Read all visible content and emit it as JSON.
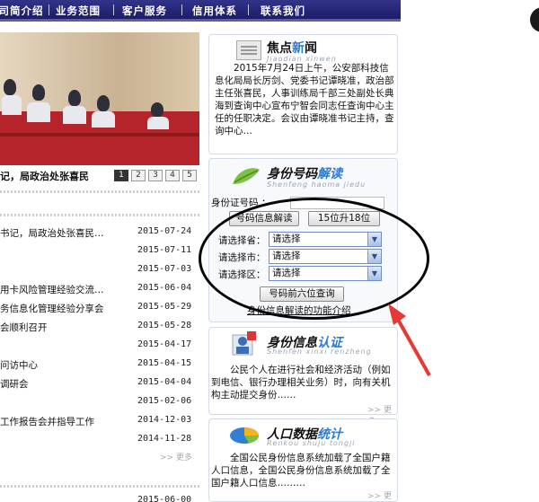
{
  "nav": {
    "items": [
      "公司简介绍",
      "业务范围",
      "客户服务",
      "信用体系",
      "联系我们"
    ]
  },
  "slideshow": {
    "caption": "记，局政治处张喜民",
    "pages": [
      "1",
      "2",
      "3",
      "4",
      "5"
    ],
    "active_page": "1"
  },
  "news": [
    {
      "title": "书记，局政治处张喜民…",
      "date": "2015-07-24"
    },
    {
      "title": "",
      "date": "2015-07-11"
    },
    {
      "title": "",
      "date": "2015-07-03"
    },
    {
      "title": "用卡风险管理经验交流…",
      "date": "2015-06-04"
    },
    {
      "title": "务信息化管理经验分享会",
      "date": "2015-05-29"
    },
    {
      "title": "会顺利召开",
      "date": "2015-05-28"
    },
    {
      "title": "",
      "date": "2015-04-17"
    },
    {
      "title": "问访中心",
      "date": "2015-04-15"
    },
    {
      "title": "调研会",
      "date": "2015-04-04"
    },
    {
      "title": "",
      "date": "2015-02-06"
    },
    {
      "title": "工作报告会并指导工作",
      "date": "2014-12-03"
    },
    {
      "title": "",
      "date": "2014-11-28"
    }
  ],
  "news_partial_date": "2015-06-00",
  "focus": {
    "title_a": "焦点",
    "title_b": "新",
    "title_c": "闻",
    "sub": "Jiaodian  xinwen",
    "body": "2015年7月24日上午，公安部科技信息化局局长厉剑、党委书记谭晓准，政治部主任张喜民，人事训练局千部三处副处长典海到查询中心宣布宁智会同志任查询中心主任的任职决定。会议由谭晓准书记主持，查询中心…"
  },
  "idcheck": {
    "title_a": "身份号码",
    "title_b": "解读",
    "sub": "Shenfeng haoma jiedu",
    "id_label": "身份证号码 ：",
    "decode_btn": "号码信息解读",
    "upgrade_btn": "15位升18位",
    "province_label": "请选择省：",
    "city_label": "请选择市：",
    "district_label": "请选择区：",
    "select_value": "请选择",
    "query_btn": "号码前六位查询",
    "function_link": "身份信息解读的功能介绍"
  },
  "auth": {
    "title_a": "身份信息",
    "title_b": "认证",
    "sub": "Shenfen  xinxi  renzheng",
    "body": "公民个人在进行社会和经济活动（例如到电信、银行办理相关业务）时，向有关机构主动提交身份……",
    "more": ">> 更多"
  },
  "stats": {
    "title_a": "人口数据",
    "title_b": "统计",
    "sub": "Renkou  shuju  tongji",
    "body": "全国公民身份信息系统加载了全国户籍人口信息，全国公民身份信息系统加载了全国户籍人口信息………",
    "more": ">> 更多"
  },
  "news_more": ">> 更多",
  "colors": {
    "nav": "#1c1c6a",
    "accent": "#2b7bd1",
    "annotation_arrow": "#e53935",
    "annotation_ellipse": "#050505"
  }
}
